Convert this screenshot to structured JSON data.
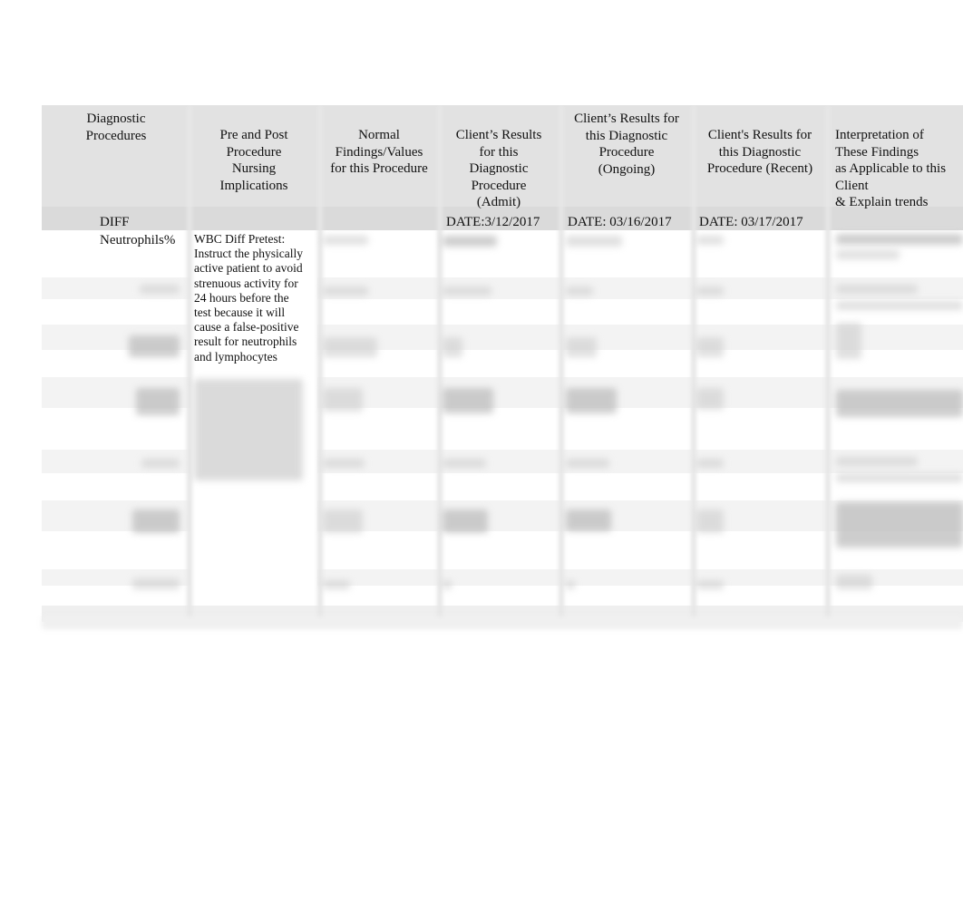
{
  "document": {
    "table": {
      "headers": [
        "Diagnostic Procedures",
        "Pre and Post Procedure Nursing Implications",
        "Normal Findings/Values for this Procedure",
        "Client’s Results for this Diagnostic Procedure (Admit)",
        "Client’s Results for this Diagnostic Procedure (Ongoing)",
        "Client's Results for this Diagnostic Procedure (Recent)",
        "Interpretation of These Findings as Applicable to this Client & Explain trends"
      ],
      "header_lines": {
        "col1": [
          "Diagnostic",
          "Procedures"
        ],
        "col2": [
          "Pre and Post",
          "Procedure",
          "Nursing",
          "Implications"
        ],
        "col3": [
          "Normal",
          "Findings/Values",
          "for this Procedure"
        ],
        "col4": [
          "Client’s Results",
          "for this",
          "Diagnostic",
          "Procedure",
          "(Admit)"
        ],
        "col5": [
          "Client’s Results for",
          "this Diagnostic",
          "Procedure",
          "(Ongoing)"
        ],
        "col6": [
          "Client's Results for",
          "this Diagnostic",
          "Procedure (Recent)"
        ],
        "col7": [
          "Interpretation of",
          "These Findings",
          "as Applicable to this",
          "Client",
          "& Explain trends"
        ]
      },
      "dates": {
        "admit": "DATE:3/12/2017",
        "ongoing": "DATE: 03/16/2017",
        "recent": "DATE: 03/17/2017"
      },
      "section_label": "DIFF",
      "first_row": {
        "procedure": "Neutrophils%",
        "nursing_implications_lines": [
          "WBC Diff Pretest:",
          "Instruct the physically",
          "active patient to avoid",
          "strenuous activity for",
          "24 hours before the",
          "test because it will",
          "cause a false-positive",
          "result for neutrophils",
          "and lymphocytes"
        ]
      },
      "obscured_rows_count": 7
    }
  }
}
